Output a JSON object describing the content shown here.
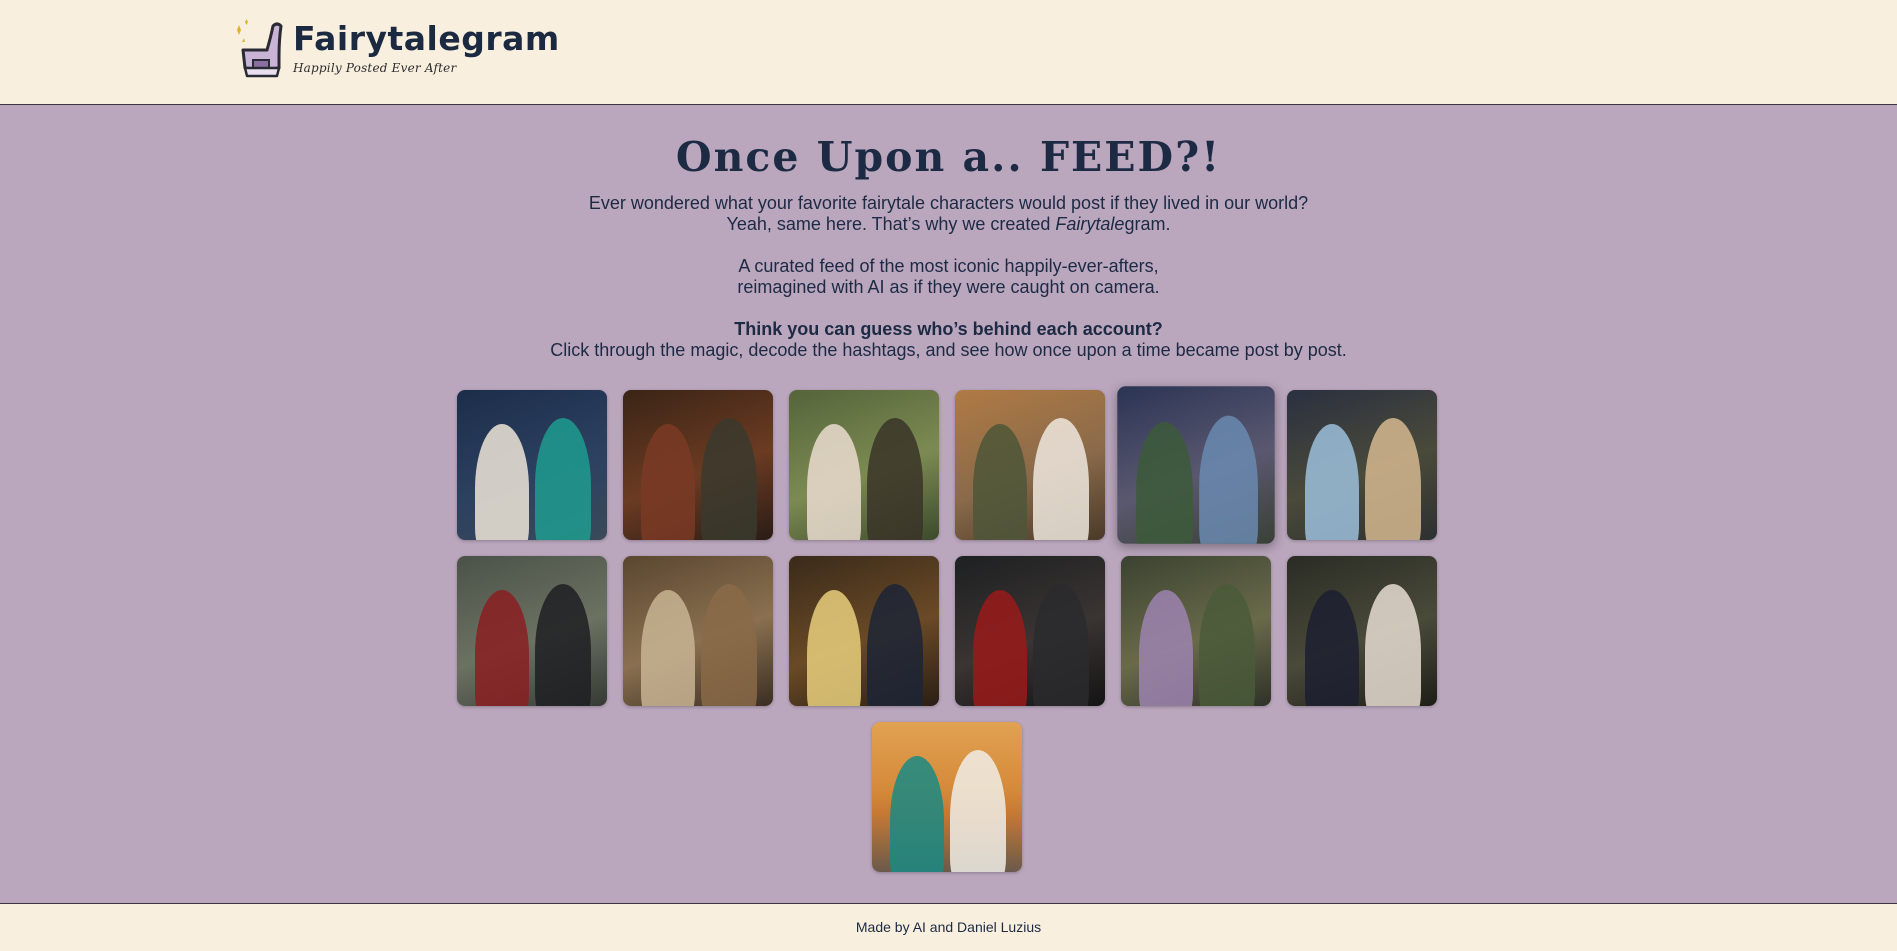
{
  "brand": {
    "title": "Fairytalegram",
    "tagline": "Happily Posted Ever After"
  },
  "hero": {
    "heading": "Once Upon a.. FEED?!",
    "line1": "Ever wondered what your favorite fairytale characters would post if they lived in our world?",
    "line2a": "Yeah, same here. That’s why we created ",
    "line2em": "Fairytale",
    "line2b": "gram.",
    "line3": "A curated feed of the most iconic happily-ever-afters,",
    "line4": "reimagined with AI as if they were caught on camera.",
    "line5": "Think you can guess who’s behind each account?",
    "line6": "Click through the magic, decode the hashtags, and see how once upon a time became post by post."
  },
  "posts": [
    {
      "bg": "linear-gradient(160deg,#1c2d4a,#2c4060 55%,#3a4a5a)",
      "a": "#efe6d8",
      "b": "#1f9c8f"
    },
    {
      "bg": "linear-gradient(160deg,#3a2416,#6b3b22 55%,#2a1c16)",
      "a": "#7a3a24",
      "b": "#3a3a2e"
    },
    {
      "bg": "linear-gradient(160deg,#55643a,#7c8a52 55%,#3c4a2c)",
      "a": "#eadccf",
      "b": "#3a3428"
    },
    {
      "bg": "linear-gradient(160deg,#b07a44,#8a6a4a 55%,#4a3a2a)",
      "a": "#4e5638",
      "b": "#eee7de"
    },
    {
      "bg": "linear-gradient(160deg,#2b3454,#5a5870 55%,#3a4036)",
      "a": "#3c5b3a",
      "b": "#6a8ab0"
    },
    {
      "bg": "linear-gradient(160deg,#2a3040,#4a4a3a 55%,#2c3030)",
      "a": "#9cc0dc",
      "b": "#d6b890"
    },
    {
      "bg": "linear-gradient(160deg,#4a5248,#6c7262 55%,#353a34)",
      "a": "#8a1e22",
      "b": "#1e1e22"
    },
    {
      "bg": "linear-gradient(160deg,#5a4630,#8a7050 55%,#3a2e22)",
      "a": "#c8b493",
      "b": "#8a6a48"
    },
    {
      "bg": "linear-gradient(160deg,#3a2a1a,#6a4a26 55%,#2a1e14)",
      "a": "#e8cf7c",
      "b": "#1c2436"
    },
    {
      "bg": "linear-gradient(160deg,#1e2022,#3a3432 55%,#141414)",
      "a": "#9a1a1a",
      "b": "#2a2a2e"
    },
    {
      "bg": "linear-gradient(160deg,#3a4230,#6a6a4a 55%,#2e3228)",
      "a": "#9c84b0",
      "b": "#4a5a3a"
    },
    {
      "bg": "linear-gradient(160deg,#2a2c24,#4a4a3a 55%,#1e1e18)",
      "a": "#1c1e30",
      "b": "#e8ddd2"
    },
    {
      "bg": "linear-gradient(180deg,#e0a252,#d58a3a 45%,#c87a34 60%,#6a5a4a)",
      "a": "#1a8a84",
      "b": "#f0ede6"
    }
  ],
  "featured_index": 4,
  "footer": {
    "credit": "Made by AI and Daniel Luzius"
  }
}
